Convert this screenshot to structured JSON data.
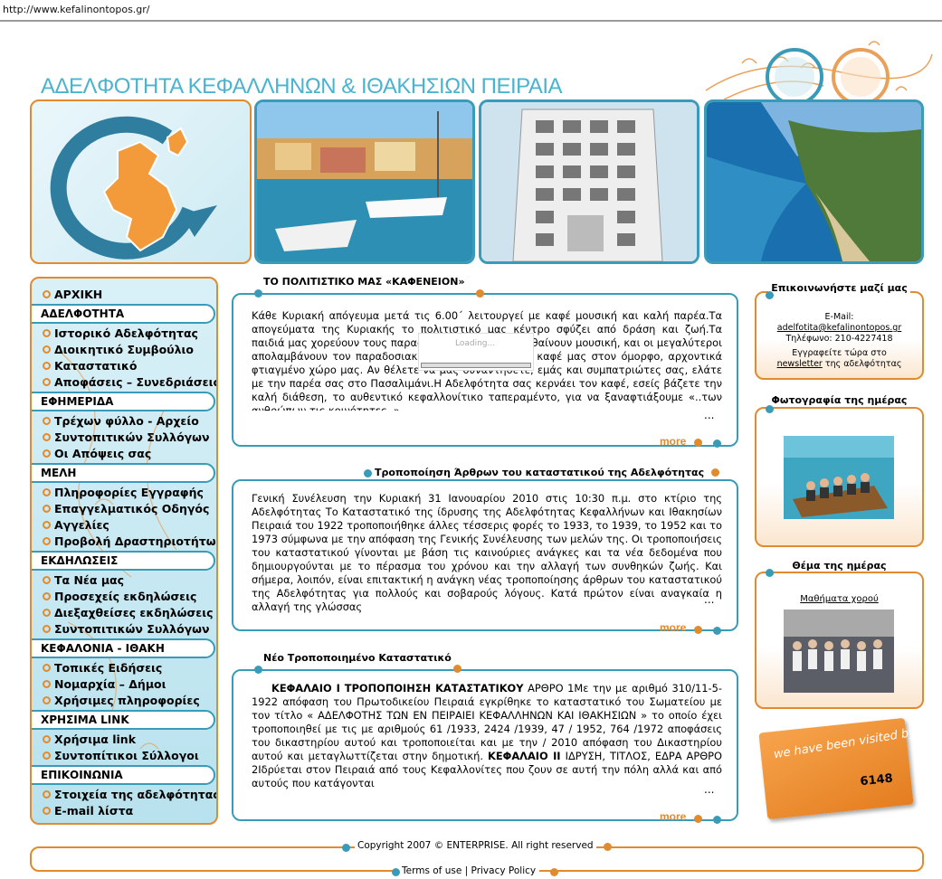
{
  "browser": {
    "url": "http://www.kefalinontopos.gr/"
  },
  "site": {
    "title": "ΑΔΕΛΦΟΤΗΤΑ ΚΕΦΑΛΛΗΝΩΝ & ΙΘΑΚΗΣΙΩΝ ΠΕΙΡΑΙΑ"
  },
  "colors": {
    "accent_orange": "#e18a2e",
    "accent_blue": "#3a9bb8",
    "title_blue": "#4ab3cf"
  },
  "sidebar": {
    "home": "ΑΡΧΙΚΗ",
    "sections": [
      {
        "title": "ΑΔΕΛΦΟΤΗΤΑ",
        "items": [
          "Ιστορικό Αδελφότητας",
          "Διοικητικό Συμβούλιο",
          "Καταστατικό",
          "Αποφάσεις – Συνεδριάσεις"
        ]
      },
      {
        "title": "ΕΦΗΜΕΡΙΔΑ",
        "items": [
          "Τρέχων φύλλο - Αρχείο",
          "Συντοπιτικών Συλλόγων",
          "Οι Απόψεις σας"
        ]
      },
      {
        "title": "ΜΕΛΗ",
        "items": [
          "Πληροφορίες Εγγραφής",
          "Επαγγελματικός Οδηγός",
          "Αγγελίες",
          "Προβολή Δραστηριοτήτων"
        ]
      },
      {
        "title": "ΕΚΔΗΛΩΣΕΙΣ",
        "items": [
          "Τα Νέα μας",
          "Προσεχείς εκδηλώσεις",
          "Διεξαχθείσες εκδηλώσεις",
          "Συντοπιτικών Συλλόγων"
        ]
      },
      {
        "title": "ΚΕΦΑΛΟΝΙΑ - ΙΘΑΚΗ",
        "items": [
          "Τοπικές Ειδήσεις",
          "Νομαρχία – Δήμοι",
          "Χρήσιμες πληροφορίες"
        ]
      },
      {
        "title": "ΧΡΗΣΙΜΑ LINK",
        "items": [
          "Χρήσιμα link",
          "Συντοπίτικοι Σύλλογοι"
        ]
      },
      {
        "title": "ΕΠΙΚΟΙΝΩΝΙΑ",
        "items": [
          "Στοιχεία της αδελφότητας",
          "E-mail λίστα"
        ]
      }
    ]
  },
  "articles": [
    {
      "title": "ΤΟ ΠΟΛΙΤΙΣΤΙΚΟ ΜΑΣ «ΚΑΦΕΝΕΙΟΝ»",
      "body": "Κάθε Κυριακή απόγευμα μετά τις 6.00΄ λειτουργεί με καφέ μουσική και καλή παρέα.Τα απογεύματα της Κυριακής το πολιτιστικό μας κέντρο σφύζει από δράση και ζωή.Τα παιδιά μας χορεύουν τους παραδοσιακούς χορούς, μαθαίνουν μουσική, και οι μεγαλύτεροι απολαμβάνουν τον παραδοσιακό ζεστό παραδοσιακό καφέ μας στον όμορφο, αρχοντικά φτιαγμένο χώρο μας. Αν θέλετε να μας συναντήσετε, εμάς και συμπατριώτες σας, ελάτε με την παρέα σας στο Πασαλιμάνι.Η Αδελφότητα σας κερνάει τον καφέ, εσείς βάζετε την καλή διάθεση, το αυθεντικό κεφαλλονίτικο ταπεραμέντο, για να ξαναφτιάξουμε «..των ανθρώπων τις κοινότητες..»",
      "ellipsis": "...",
      "more": "more"
    },
    {
      "title": "Τροποποίηση Άρθρων του καταστατικού της Αδελφότητας",
      "body": "Γενική Συνέλευση την Κυριακή 31 Ιανουαρίου 2010 στις 10:30 π.μ. στο κτίριο της Αδελφότητας Το Καταστατικό της ίδρυσης της Αδελφότητας Κεφαλλήνων και Ιθακησίων Πειραιά του 1922 τροποποιήθηκε άλλες τέσσερις φορές το 1933, το 1939, το 1952 και το 1973 σύμφωνα με την απόφαση της Γενικής Συνέλευσης των μελών της. Οι τροποποιήσεις του καταστατικού γίνονται με βάση τις καινούριες ανάγκες και τα νέα δεδομένα που δημιουργούνται με το πέρασμα του χρόνου και την αλλαγή των συνθηκών ζωής. Και σήμερα, λοιπόν, είναι επιτακτική η ανάγκη νέας τροποποίησης άρθρων του καταστατικού της Αδελφότητας για πολλούς και σοβαρούς λόγους. Κατά πρώτον είναι αναγκαία η αλλαγή της γλώσσας",
      "ellipsis": "...",
      "more": "more"
    },
    {
      "title": "Νέο Τροποποιημένο Καταστατικό",
      "body_heading1": "ΚΕΦΑΛΑΙΟ Ι ΤΡΟΠΟΠΟΙΗΣΗ ΚΑΤΑΣΤΑΤΙΚΟΥ",
      "body_part1": "ΑΡΘΡΟ 1Με την με αριθμό 310/11-5-1922 απόφαση του Πρωτοδικείου Πειραιά εγκρίθηκε το καταστατικό του Σωματείου με τον τίτλο « ΑΔΕΛΦΟΤΗΣ ΤΩΝ ΕΝ ΠΕΙΡΑΙΕΙ ΚΕΦΑΛΛΗΝΩΝ ΚΑΙ ΙΘΑΚΗΣΙΩΝ » το οποίο έχει τροποποιηθεί με τις με αριθμούς 61 /1933, 2424 /1939, 47 / 1952, 764 /1972 αποφάσεις του δικαστηρίου αυτού και τροποποιείται και με την / 2010 απόφαση του Δικαστηρίου αυτού και μεταγλωττίζεται στην δημοτική.",
      "body_heading2": "ΚΕΦΑΛΑΙΟ ΙΙ",
      "body_part2": "ΙΔΡΥΣΗ, ΤΙΤΛΟΣ, ΕΔΡΑ ΑΡΘΡΟ 2Ιδρύεται στον Πειραιά από τους Κεφαλλονίτες που ζουν σε αυτή την πόλη αλλά και από αυτούς που κατάγονται",
      "ellipsis": "...",
      "more": "more"
    }
  ],
  "loading": {
    "text": "Loading..."
  },
  "contact": {
    "title": "Επικοινωνήστε μαζί μας",
    "email_label": "E-Mail:",
    "email": "adelfotita@kefalinontopos.gr",
    "phone": "Τηλέφωνο: 210-4227418",
    "newsletter_pre": "Εγγραφείτε τώρα στο",
    "newsletter_link": "newsletter",
    "newsletter_post": "της αδελφότητας"
  },
  "photo_of_day": {
    "title": "Φωτογραφία της ημέρας"
  },
  "theme_of_day": {
    "title": "Θέμα της ημέρας",
    "link": "Μαθήματα χορού"
  },
  "visitors": {
    "label": "we have been visited by:",
    "count": "6148"
  },
  "footer": {
    "copyright": "Copyright 2007 © ENTERPRISE. All right reserved",
    "terms": "Terms of use",
    "sep": "|",
    "privacy": "Privacy Policy"
  }
}
